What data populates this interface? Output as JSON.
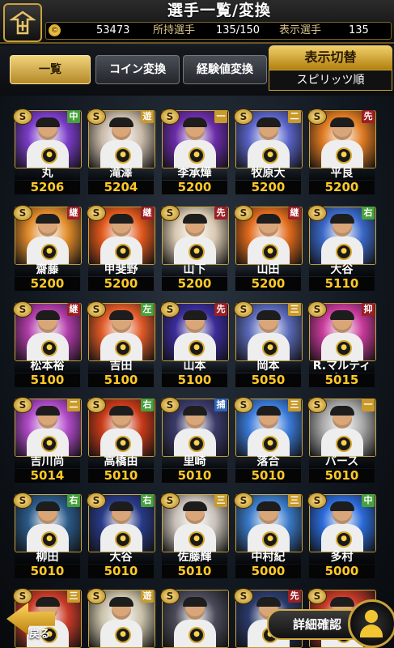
{
  "header": {
    "title": "選手一覧/変換",
    "coin_symbol": "©",
    "coins": "53473",
    "owned_label": "所持選手",
    "owned": "135/150",
    "shown_label": "表示選手",
    "shown": "135"
  },
  "tabs": [
    {
      "label": "一覧",
      "active": true
    },
    {
      "label": "コイン変換",
      "active": false
    },
    {
      "label": "経験値変換",
      "active": false
    }
  ],
  "sort": {
    "title": "表示切替",
    "value": "スピリッツ順"
  },
  "cards": [
    {
      "rank": "S",
      "pos": "中",
      "pos_color": "nm",
      "name": "丸",
      "spirit": "5206",
      "bg": "#7a3cc8"
    },
    {
      "rank": "S",
      "pos": "遊",
      "pos_color": "ss",
      "name": "滝澤",
      "spirit": "5204",
      "bg": "#c8b9a8"
    },
    {
      "rank": "S",
      "pos": "一",
      "pos_color": "in",
      "name": "李承燁",
      "spirit": "5200",
      "bg": "#6a2ca8"
    },
    {
      "rank": "S",
      "pos": "二",
      "pos_color": "in",
      "name": "牧原大",
      "spirit": "5200",
      "bg": "#5a64c8"
    },
    {
      "rank": "S",
      "pos": "先",
      "pos_color": "dh",
      "name": "平良",
      "spirit": "5200",
      "bg": "#e07a22"
    },
    {
      "rank": "S",
      "pos": "継",
      "pos_color": "dh",
      "name": "齋藤",
      "spirit": "5200",
      "bg": "#e08a2a"
    },
    {
      "rank": "S",
      "pos": "継",
      "pos_color": "dh",
      "name": "甲斐野",
      "spirit": "5200",
      "bg": "#e0581c"
    },
    {
      "rank": "S",
      "pos": "先",
      "pos_color": "dh",
      "name": "山下",
      "spirit": "5200",
      "bg": "#d8c8b0"
    },
    {
      "rank": "S",
      "pos": "継",
      "pos_color": "dh",
      "name": "山田",
      "spirit": "5200",
      "bg": "#e06a1c"
    },
    {
      "rank": "S",
      "pos": "右",
      "pos_color": "nm",
      "name": "大谷",
      "spirit": "5110",
      "bg": "#3a68c8"
    },
    {
      "rank": "S",
      "pos": "継",
      "pos_color": "dh",
      "name": "松本裕",
      "spirit": "5100",
      "bg": "#b03ca8"
    },
    {
      "rank": "S",
      "pos": "左",
      "pos_color": "nm",
      "name": "吉田",
      "spirit": "5100",
      "bg": "#e05a28"
    },
    {
      "rank": "S",
      "pos": "先",
      "pos_color": "dh",
      "name": "山本",
      "spirit": "5100",
      "bg": "#3a2c98"
    },
    {
      "rank": "S",
      "pos": "三",
      "pos_color": "in",
      "name": "岡本",
      "spirit": "5050",
      "bg": "#5a6ab8"
    },
    {
      "rank": "S",
      "pos": "抑",
      "pos_color": "dh",
      "name": "R.マルティネス",
      "spirit": "5015",
      "bg": "#c83a9a"
    },
    {
      "rank": "S",
      "pos": "二",
      "pos_color": "in",
      "name": "吉川尚",
      "spirit": "5014",
      "bg": "#b04ac8"
    },
    {
      "rank": "S",
      "pos": "右",
      "pos_color": "nm",
      "name": "高橋由",
      "spirit": "5010",
      "bg": "#c83a18"
    },
    {
      "rank": "S",
      "pos": "捕",
      "pos_color": "c",
      "name": "里崎",
      "spirit": "5010",
      "bg": "#3a3a6a"
    },
    {
      "rank": "S",
      "pos": "三",
      "pos_color": "in",
      "name": "落合",
      "spirit": "5010",
      "bg": "#3a7ad8"
    },
    {
      "rank": "S",
      "pos": "一",
      "pos_color": "in",
      "name": "バース",
      "spirit": "5010",
      "bg": "#a8a8a8"
    },
    {
      "rank": "S",
      "pos": "右",
      "pos_color": "nm",
      "name": "柳田",
      "spirit": "5010",
      "bg": "#2a5a88"
    },
    {
      "rank": "S",
      "pos": "右",
      "pos_color": "nm",
      "name": "大谷",
      "spirit": "5010",
      "bg": "#283a88"
    },
    {
      "rank": "S",
      "pos": "三",
      "pos_color": "in",
      "name": "佐藤輝",
      "spirit": "5010",
      "bg": "#c8c0b8"
    },
    {
      "rank": "S",
      "pos": "三",
      "pos_color": "in",
      "name": "中村紀",
      "spirit": "5000",
      "bg": "#3a7ac8"
    },
    {
      "rank": "S",
      "pos": "中",
      "pos_color": "nm",
      "name": "多村",
      "spirit": "5000",
      "bg": "#2a6ad8"
    },
    {
      "rank": "S",
      "pos": "三",
      "pos_color": "in",
      "name": "",
      "spirit": "",
      "bg": "#c83a28"
    },
    {
      "rank": "S",
      "pos": "遊",
      "pos_color": "ss",
      "name": "",
      "spirit": "",
      "bg": "#c8c0a8"
    },
    {
      "rank": "S",
      "pos": "",
      "pos_color": "nm",
      "name": "",
      "spirit": "",
      "bg": "#4a4a5a"
    },
    {
      "rank": "S",
      "pos": "先",
      "pos_color": "dh",
      "name": "",
      "spirit": "",
      "bg": "#2a3a6a"
    },
    {
      "rank": "S",
      "pos": "",
      "pos_color": "nm",
      "name": "",
      "spirit": "",
      "bg": "#c83a28"
    }
  ],
  "footer": {
    "back_label": "戻る",
    "detail_label": "詳細確認"
  }
}
